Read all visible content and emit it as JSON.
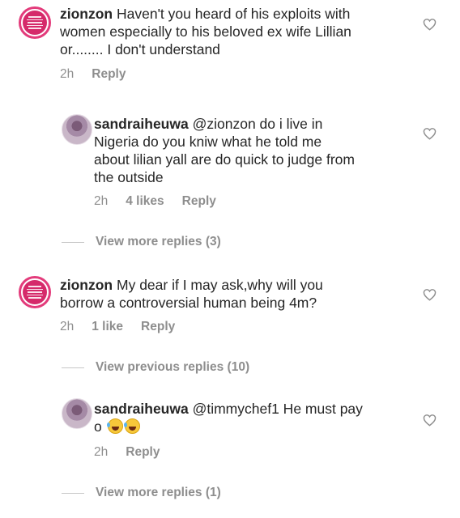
{
  "comments": [
    {
      "username": "zionzon",
      "lines": [
        "Haven't you heard of his exploits with",
        "women especially to his beloved ex wife Lillian",
        "or........ I don't understand"
      ],
      "time": "2h",
      "reply": "Reply",
      "avatar_text": "influencing others to hate someone is an act of witchcraft"
    },
    {
      "username": "sandraiheuwa",
      "lines": [
        "@zionzon do i live in",
        "Nigeria do you kniw what he told me",
        "about lilian yall are do quick to judge from",
        "the outside"
      ],
      "time": "2h",
      "likes": "4 likes",
      "reply": "Reply"
    },
    {
      "username": "zionzon",
      "lines": [
        "My dear if I may ask,why will you",
        "borrow a controversial human being 4m?"
      ],
      "time": "2h",
      "likes": "1 like",
      "reply": "Reply",
      "avatar_text": "influencing others to hate someone is an act of witchcraft"
    },
    {
      "username": "sandraiheuwa",
      "lines": [
        "@timmychef1 He must pay",
        "o"
      ],
      "time": "2h",
      "reply": "Reply"
    }
  ],
  "view_more_1": "View more replies (3)",
  "view_previous": "View previous replies (10)",
  "view_more_2": "View more replies (1)",
  "icons": {
    "like": "heart-outline-icon",
    "emoji": "face-with-tears-of-joy-icon"
  },
  "colors": {
    "text": "#262626",
    "meta": "#8e8e8e",
    "brand_avatar": "#e33b7b"
  }
}
